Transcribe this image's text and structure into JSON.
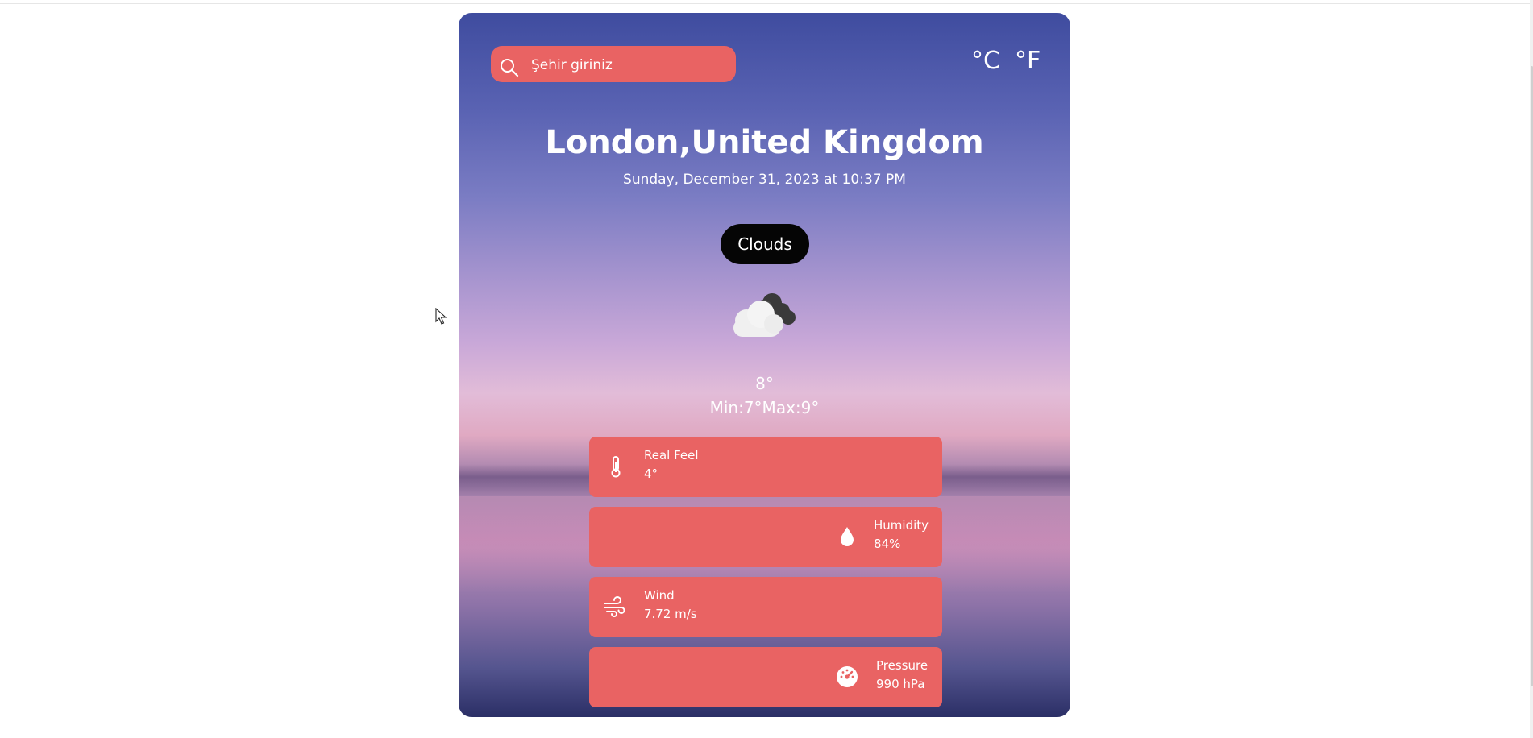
{
  "search": {
    "placeholder": "Şehir giriniz"
  },
  "units": {
    "celsius": "°C",
    "fahrenheit": "°F"
  },
  "location": {
    "city": "London,United Kingdom"
  },
  "datetime": "Sunday, December 31, 2023 at 10:37 PM",
  "condition": "Clouds",
  "icons": {
    "search": "search-icon",
    "weather": "cloudy-icon",
    "real_feel": "thermometer-icon",
    "humidity": "water-drop-icon",
    "wind": "wind-icon",
    "pressure": "gauge-icon"
  },
  "temperature": {
    "current": "8°",
    "minmax": "Min:7°Max:9°"
  },
  "details": {
    "real_feel": {
      "label": "Real Feel",
      "value": "4°"
    },
    "humidity": {
      "label": "Humidity",
      "value": "84%"
    },
    "wind": {
      "label": "Wind",
      "value": "7.72 m/s"
    },
    "pressure": {
      "label": "Pressure",
      "value": "990 hPa"
    }
  },
  "colors": {
    "accent": "#e96363",
    "badge": "#050505",
    "text": "#ffffff"
  }
}
